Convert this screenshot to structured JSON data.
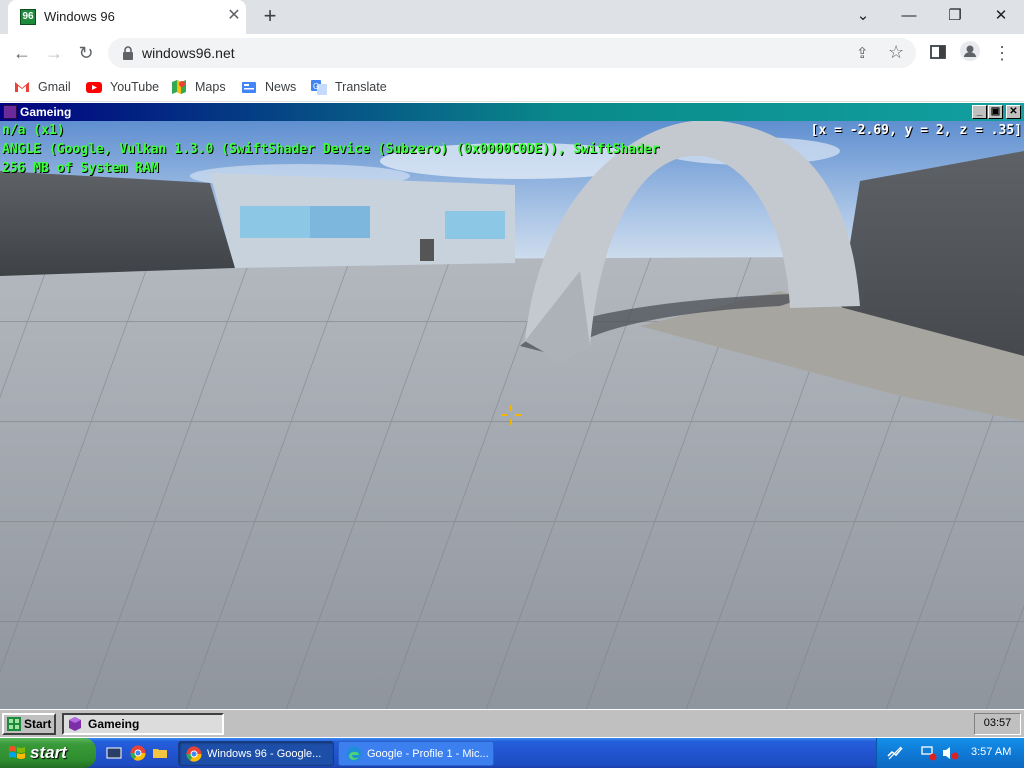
{
  "browser": {
    "tab": {
      "title": "Windows 96"
    },
    "url": "windows96.net",
    "bookmarks": [
      {
        "label": "Gmail",
        "icon": "gmail-icon"
      },
      {
        "label": "YouTube",
        "icon": "youtube-icon"
      },
      {
        "label": "Maps",
        "icon": "maps-icon"
      },
      {
        "label": "News",
        "icon": "news-icon"
      },
      {
        "label": "Translate",
        "icon": "translate-icon"
      }
    ]
  },
  "win96_window": {
    "title": "Gameing",
    "controls": {
      "minimize": "_",
      "maximize": "▣",
      "close": "✕"
    }
  },
  "game": {
    "hud": {
      "line1": "n/a (x1)",
      "line2": "ANGLE (Google, Vulkan 1.3.0 (SwiftShader Device (Subzero) (0x0000C0DE)), SwiftShader",
      "line3": "256 MB of System RAM",
      "coords": "[x = -2.69, y = 2, z = .35]"
    },
    "hud_color": "#3cff3c"
  },
  "win96_taskbar": {
    "start_label": "Start",
    "task_label": "Gameing",
    "clock": "03:57"
  },
  "xp_taskbar": {
    "start_label": "start",
    "tasks": [
      {
        "label": "Windows 96 - Google..."
      },
      {
        "label": "Google - Profile 1 - Mic..."
      }
    ],
    "clock": "3:57 AM"
  }
}
